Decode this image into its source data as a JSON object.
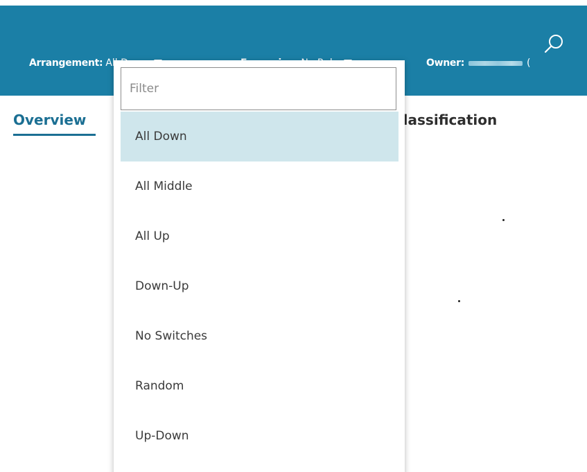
{
  "header": {
    "arrangement": {
      "label": "Arrangement:",
      "value": "All Down"
    },
    "expansion": {
      "label": "Expansion:",
      "value": "No Rule"
    },
    "owner": {
      "label": "Owner:",
      "paren": "("
    },
    "search_icon": "search-icon",
    "colors": {
      "bar": "#1b7fa6",
      "text": "#ffffff"
    }
  },
  "tabs": {
    "overview": "Overview",
    "classification": "Classification"
  },
  "dropdown": {
    "filter_placeholder": "Filter",
    "filter_value": "",
    "selected": "All Down",
    "options": [
      "All Down",
      "All Middle",
      "All Up",
      "Down-Up",
      "No Switches",
      "Random",
      "Up-Down"
    ],
    "colors": {
      "selected_bg": "#cfe6ec"
    }
  }
}
